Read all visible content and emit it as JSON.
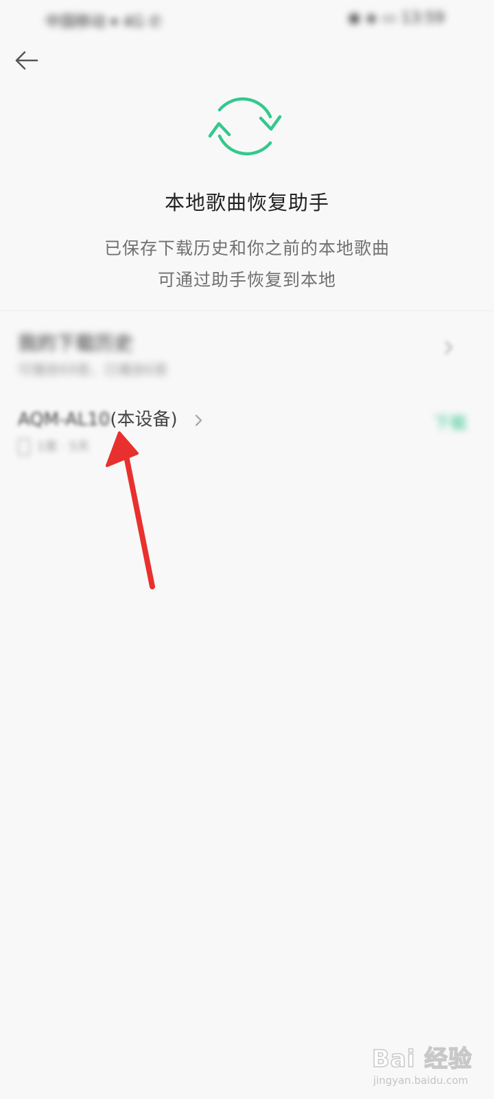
{
  "status_bar": {
    "left": "中国移动 ▾ 4G ✆",
    "right": "◉ ◈ ▭ 13:59"
  },
  "header": {
    "back_icon": "back-arrow-icon"
  },
  "hero": {
    "icon": "sync-icon",
    "accent_color": "#34c88d",
    "title": "本地歌曲恢复助手",
    "description_line_1": "已保存下载历史和你之前的本地歌曲",
    "description_line_2": "可通过助手恢复到本地"
  },
  "history": {
    "title": "我的下载历史",
    "subtitle": "可播放69首，已播放6首"
  },
  "device": {
    "name_prefix": "AQM-AL10",
    "name_suffix": "(本设备)",
    "info": "1首 · 5天",
    "download_label": "下载"
  },
  "annotation": {
    "arrow_color": "#e8302e"
  },
  "watermark": {
    "logo": "Bai 经验",
    "url": "jingyan.baidu.com"
  }
}
